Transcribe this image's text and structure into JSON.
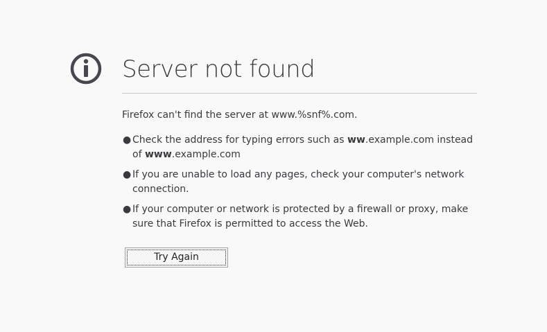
{
  "error": {
    "icon": "info-circle-icon",
    "title": "Server not found",
    "description": "Firefox can't find the server at www.%snf%.com.",
    "suggestions": [
      {
        "pre": "Check the address for typing errors such as ",
        "bold1": "ww",
        "mid": ".example.com instead of ",
        "bold2": "www",
        "post": ".example.com"
      },
      {
        "text": "If you are unable to load any pages, check your computer's network connection."
      },
      {
        "text": "If your computer or network is protected by a firewall or proxy, make sure that Firefox is permitted to access the Web."
      }
    ],
    "bullet": "●",
    "try_again_label": "Try Again"
  },
  "colors": {
    "background": "#f9f9fa",
    "text": "#3a3a3e",
    "icon": "#474750",
    "divider": "#c8c8cc"
  }
}
